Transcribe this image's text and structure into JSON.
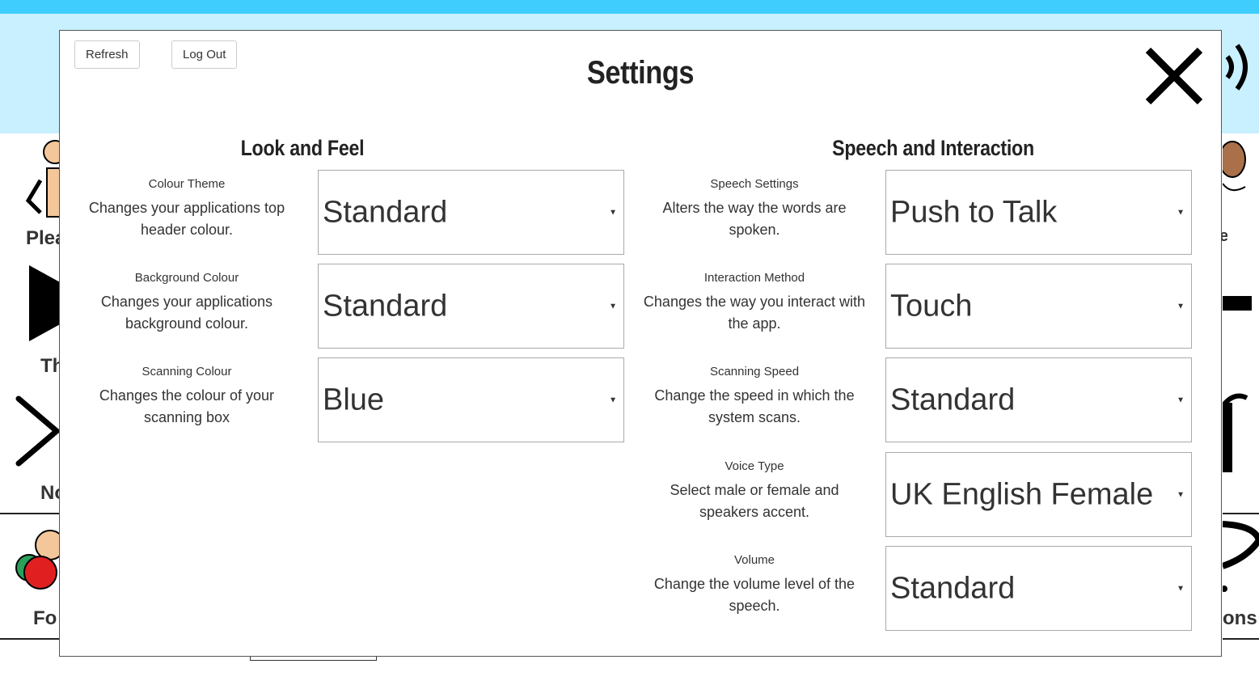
{
  "background": {
    "labels": [
      "Plea",
      "Th",
      "No",
      "Fo",
      "e",
      "ons"
    ],
    "colors": {
      "top_bar": "#3fcdfe",
      "header": "#c8f0ff"
    }
  },
  "modal": {
    "title": "Settings",
    "refresh_label": "Refresh",
    "logout_label": "Log Out",
    "look_and_feel": {
      "title": "Look and Feel",
      "settings": [
        {
          "label": "Colour Theme",
          "help": "Changes your applications top header colour.",
          "value": "Standard"
        },
        {
          "label": "Background Colour",
          "help": "Changes your applications background colour.",
          "value": "Standard"
        },
        {
          "label": "Scanning Colour",
          "help": "Changes the colour of your scanning box",
          "value": "Blue"
        }
      ]
    },
    "speech_and_interaction": {
      "title": "Speech and Interaction",
      "settings": [
        {
          "label": "Speech Settings",
          "help": "Alters the way the words are spoken.",
          "value": "Push to Talk"
        },
        {
          "label": "Interaction Method",
          "help": "Changes the way you interact with the app.",
          "value": "Touch"
        },
        {
          "label": "Scanning Speed",
          "help": "Change the speed in which the system scans.",
          "value": "Standard"
        },
        {
          "label": "Voice Type",
          "help": "Select male or female and speakers accent.",
          "value": "UK English Female"
        },
        {
          "label": "Volume",
          "help": "Change the volume level of the speech.",
          "value": "Standard"
        }
      ]
    },
    "icons": {
      "close": "close-icon",
      "dropdown": "caret-down-icon",
      "speaker": "speaker-icon"
    }
  }
}
